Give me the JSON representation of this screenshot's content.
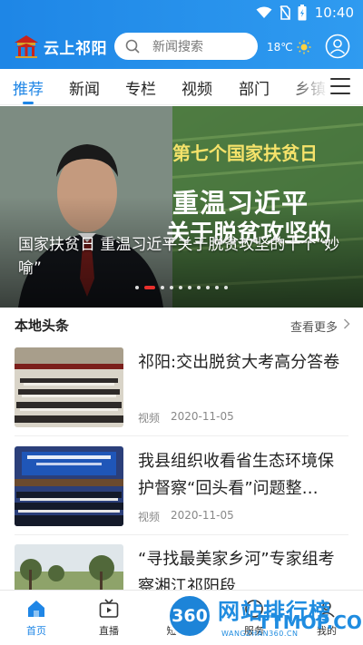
{
  "status_bar": {
    "time": "10:40"
  },
  "header": {
    "app_name": "云上祁阳",
    "search_placeholder": "新闻搜索",
    "temperature": "18℃"
  },
  "tabs": [
    "推荐",
    "新闻",
    "专栏",
    "视频",
    "部门",
    "乡镇"
  ],
  "hero": {
    "tag": "第七个国家扶贫日",
    "line1": "重温习近平",
    "line2": "关于脱贫攻坚的",
    "caption": "国家扶贫日 重温习近平关于脱贫攻坚的十个“妙喻”",
    "slide_count": 10,
    "active_slide": 2
  },
  "section": {
    "title": "本地头条",
    "more": "查看更多"
  },
  "news": [
    {
      "title": "祁阳:交出脱贫大考高分答卷",
      "type": "视频",
      "date": "2020-11-05"
    },
    {
      "title": "我县组织收看省生态环境保护督察“回头看”问题整…",
      "type": "视频",
      "date": "2020-11-05"
    },
    {
      "title": "“寻找最美家乡河”专家组考察湘江祁阳段",
      "type": "",
      "date": ""
    }
  ],
  "bottom_nav": [
    "首页",
    "直播",
    "短视频",
    "服务",
    "我的"
  ],
  "watermark": {
    "badge": "360",
    "text": "网站排行榜",
    "url": "TTMOP.COM",
    "sub": "WANGZHAN360.CN"
  },
  "colors": {
    "brand": "#1f86e6",
    "active_dot": "#e8302c"
  }
}
